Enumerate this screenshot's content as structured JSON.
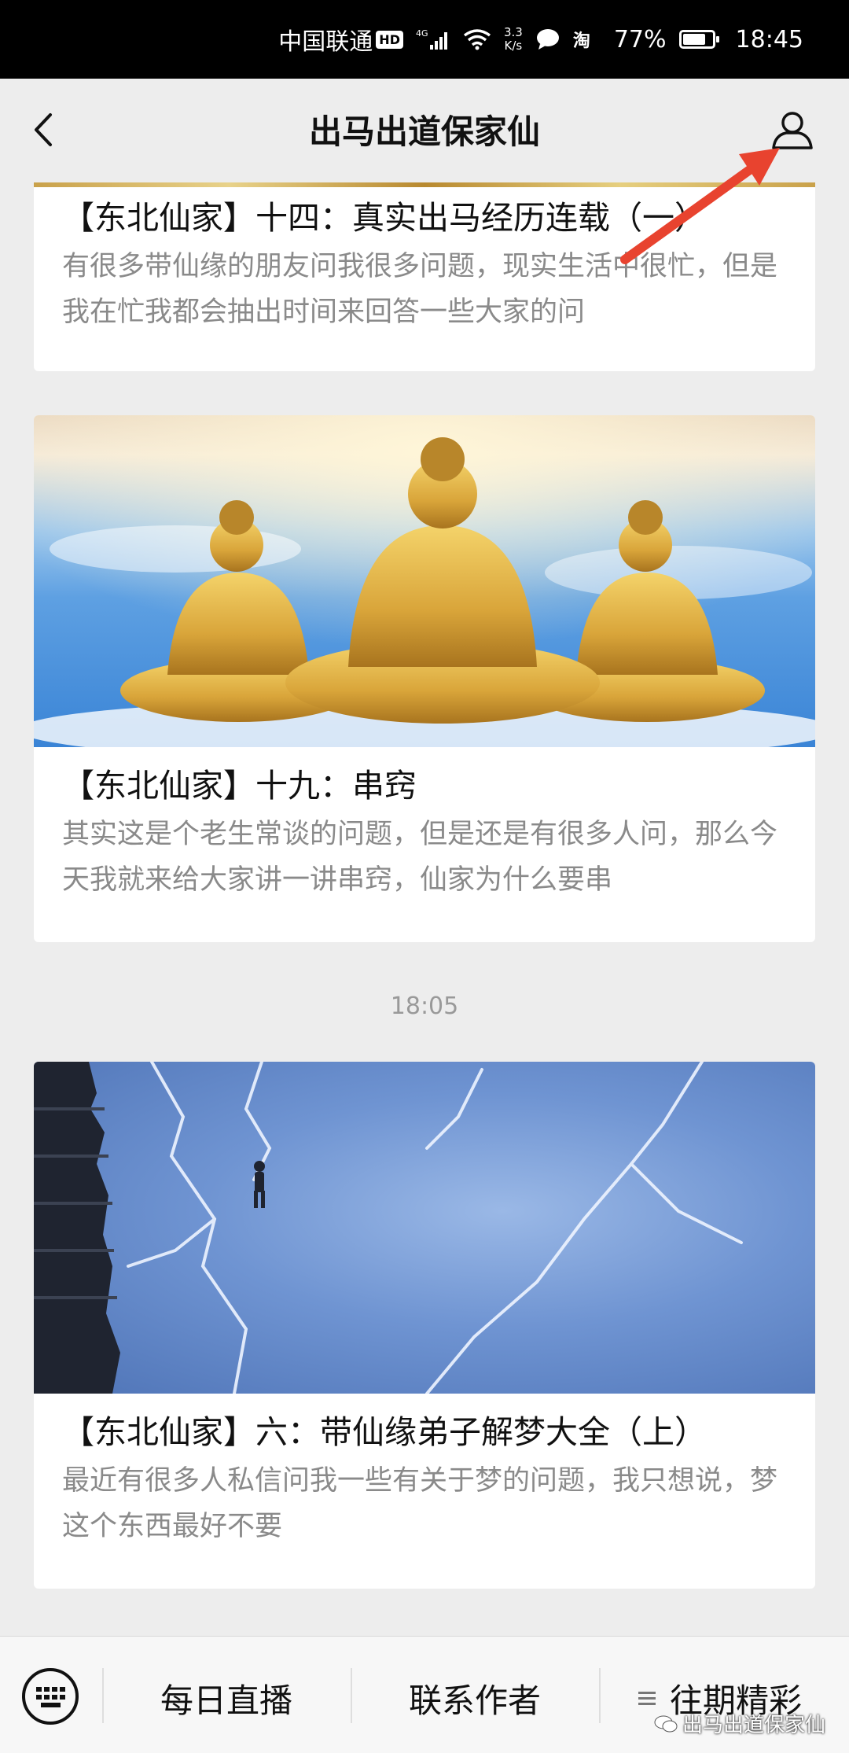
{
  "status_bar": {
    "carrier": "中国联通",
    "hd": "HD",
    "signal_type": "4G",
    "net_speed_value": "3.3",
    "net_speed_unit": "K/s",
    "app_icon_2": "淘",
    "battery_percent": "77%",
    "battery_level": 0.77,
    "time": "18:45"
  },
  "nav": {
    "title": "出马出道保家仙",
    "back_icon": "chevron-left-icon",
    "profile_icon": "person-icon"
  },
  "articles": [
    {
      "title": "【东北仙家】十四：真实出马经历连载（一）",
      "desc": "有很多带仙缘的朋友问我很多问题，现实生活中很忙，但是我在忙我都会抽出时间来回答一些大家的问"
    },
    {
      "title": "【东北仙家】十九：串窍",
      "desc": "其实这是个老生常谈的问题，但是还是有很多人问，那么今天我就来给大家讲一讲串窍，仙家为什么要串"
    },
    {
      "title": "【东北仙家】六：带仙缘弟子解梦大全（上）",
      "desc": "最近有很多人私信问我一些有关于梦的问题，我只想说，梦这个东西最好不要"
    }
  ],
  "timestamp": "18:05",
  "bottom_menu": {
    "keyboard_icon": "keyboard-icon",
    "items": [
      "每日直播",
      "联系作者",
      "往期精彩"
    ],
    "menu_icon": "list-icon"
  },
  "watermark": "出马出道保家仙",
  "colors": {
    "accent_arrow": "#e8432f",
    "background": "#ededed",
    "status_bar": "#000000"
  }
}
